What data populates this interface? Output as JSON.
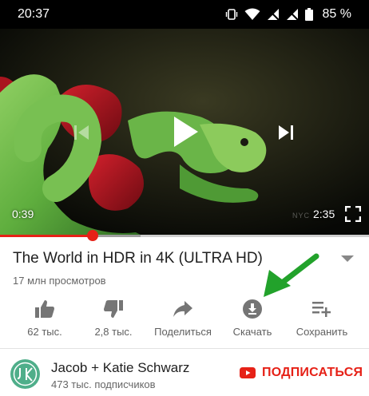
{
  "status_bar": {
    "time": "20:37",
    "battery": "85 %",
    "icons": [
      "vibrate-icon",
      "wifi-icon",
      "no-signal-icon",
      "no-signal-icon",
      "battery-icon"
    ]
  },
  "player": {
    "current_time": "0:39",
    "duration": "2:35",
    "progress": 0.25,
    "buffered": 0.38,
    "watermark": "NYC",
    "controls": [
      "skip-previous-icon",
      "play-icon",
      "skip-next-icon",
      "fullscreen-icon"
    ]
  },
  "video": {
    "title": "The World in HDR in 4K (ULTRA HD)",
    "views": "17 млн просмотров"
  },
  "actions": [
    {
      "icon": "thumbs-up-icon",
      "label": "62 тыс."
    },
    {
      "icon": "thumbs-down-icon",
      "label": "2,8 тыс."
    },
    {
      "icon": "share-icon",
      "label": "Поделиться"
    },
    {
      "icon": "download-icon",
      "label": "Скачать"
    },
    {
      "icon": "playlist-add-icon",
      "label": "Сохранить"
    }
  ],
  "channel": {
    "name": "Jacob + Katie Schwarz",
    "subscribers": "473 тыс. подписчиков",
    "subscribe_label": "ПОДПИСАТЬСЯ"
  },
  "colors": {
    "accent_red": "#e62117",
    "annotation_green": "#22a22b",
    "avatar_green": "#4fae8a"
  }
}
